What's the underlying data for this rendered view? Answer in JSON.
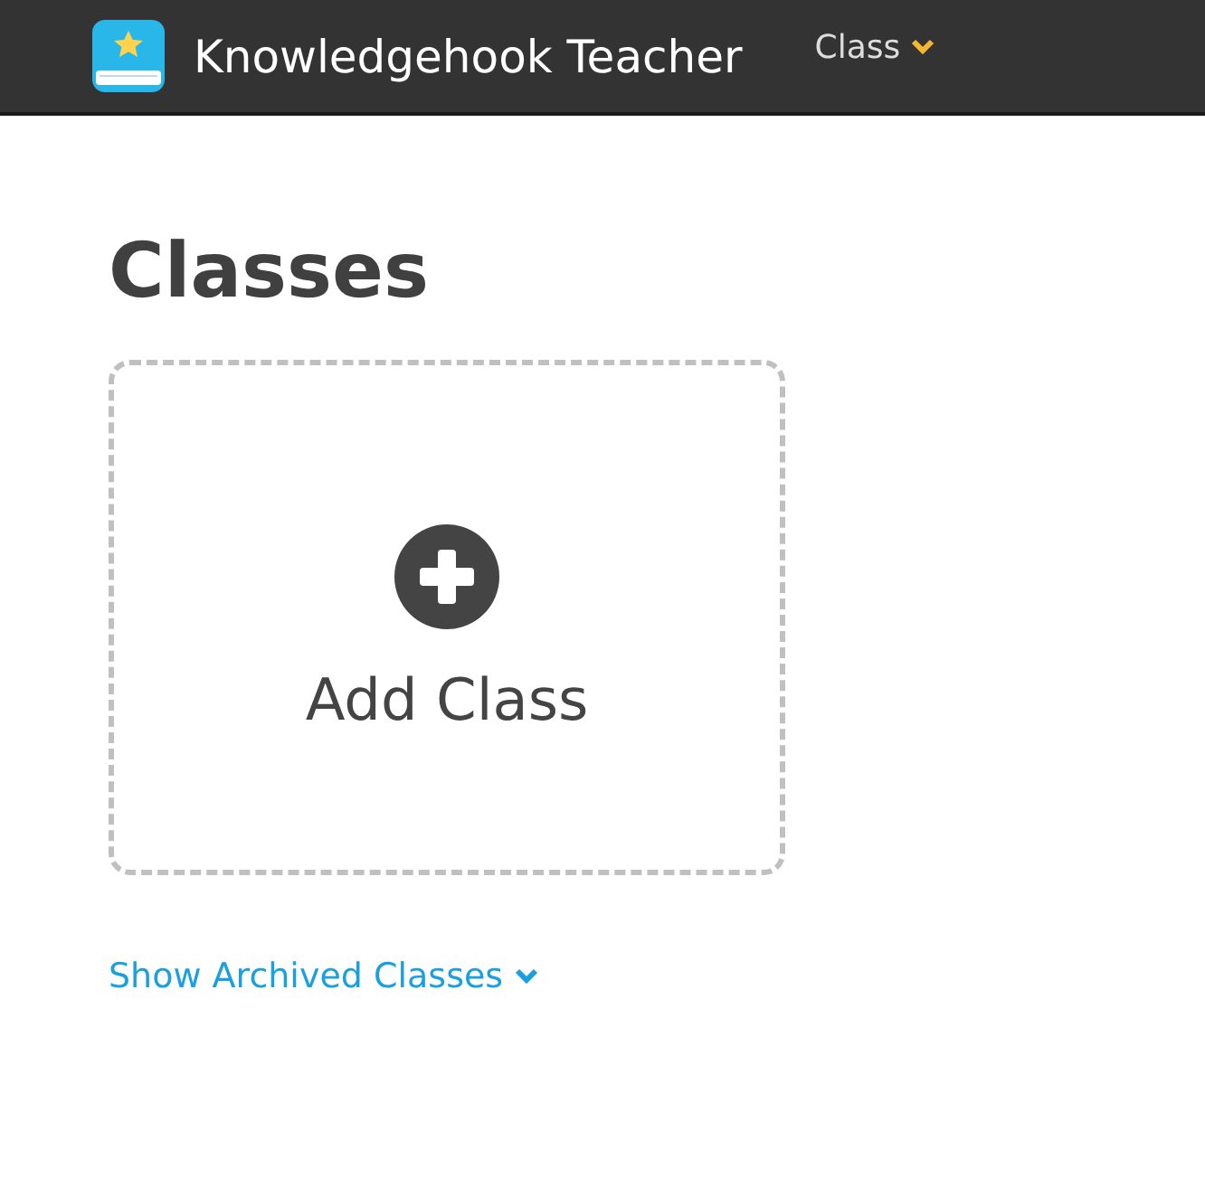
{
  "navbar": {
    "app_title": "Knowledgehook Teacher",
    "menu": "Class"
  },
  "page": {
    "title": "Classes",
    "add_card": "Add Class",
    "archived_link": "Show Archived Classes"
  }
}
